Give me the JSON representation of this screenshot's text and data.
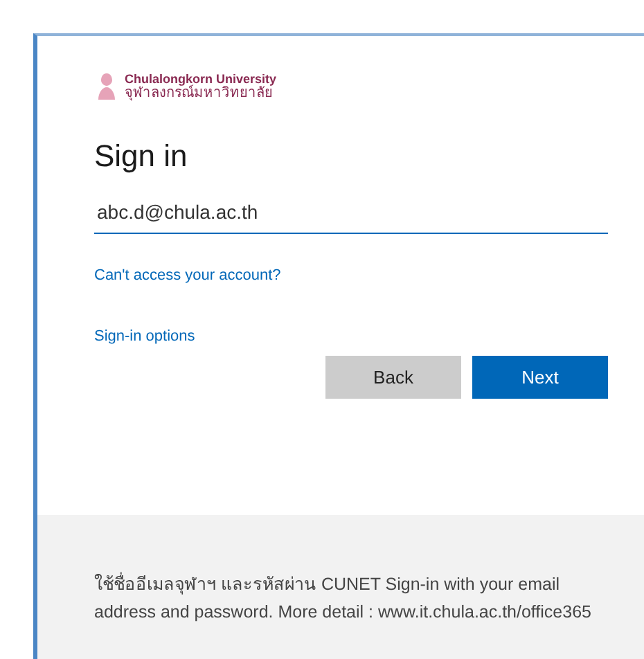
{
  "logo": {
    "name_en": "Chulalongkorn University",
    "name_th": "จุฬาลงกรณ์มหาวิทยาลัย"
  },
  "title": "Sign in",
  "email_field": {
    "value": "abc.d@chula.ac.th"
  },
  "links": [
    "Can't access your account?",
    "Sign-in options"
  ],
  "buttons": [
    {
      "label": "Back",
      "kind": "secondary"
    },
    {
      "label": "Next",
      "kind": "primary"
    }
  ],
  "footer": {
    "text": "ใช้ชื่ออีเมลจุฬาฯ และรหัสผ่าน CUNET Sign-in with your email address and password. More detail : www.it.chula.ac.th/office365"
  }
}
